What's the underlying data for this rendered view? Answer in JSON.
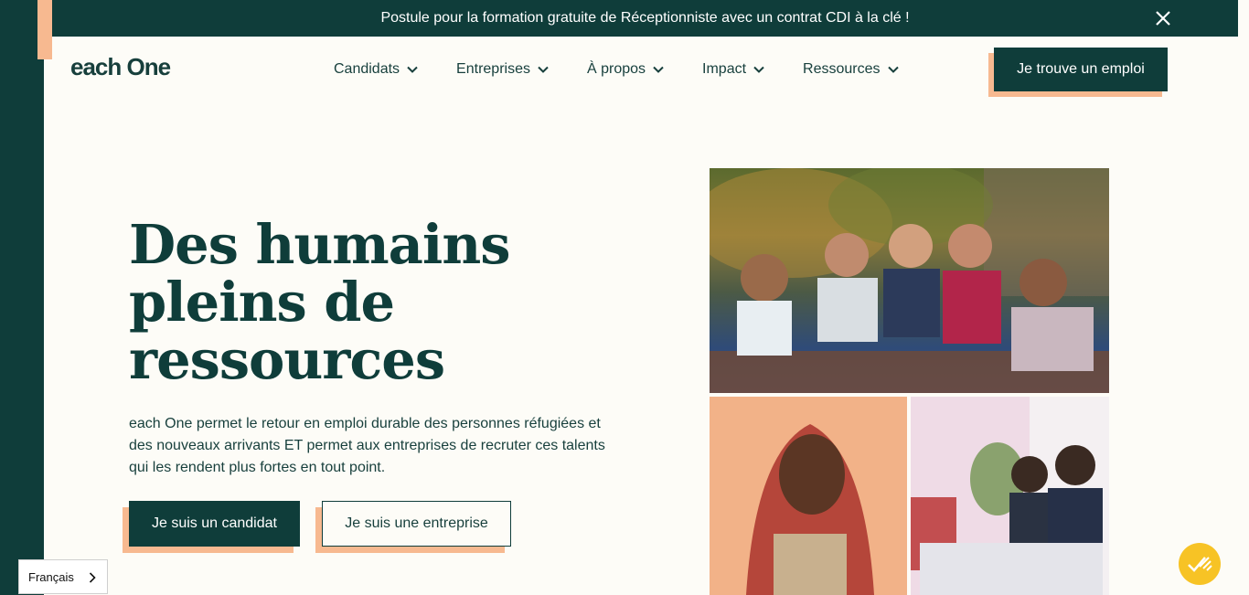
{
  "announcement": {
    "text": "Postule pour la formation gratuite de Réceptionniste avec un contrat CDI à la clé !",
    "close_icon": "close-icon"
  },
  "header": {
    "logo": "each One",
    "nav": [
      {
        "label": "Candidats"
      },
      {
        "label": "Entreprises"
      },
      {
        "label": "À propos"
      },
      {
        "label": "Impact"
      },
      {
        "label": "Ressources"
      }
    ],
    "cta_label": "Je trouve un emploi"
  },
  "hero": {
    "title_line1": "Des humains",
    "title_line2": "pleins de",
    "title_line3": "ressources",
    "description": "each One permet le retour en emploi durable des personnes réfugiées et des nouveaux arrivants ET permet aux entreprises de recruter ces talents qui les rendent plus fortes en tout point.",
    "primary_button": "Je suis un candidat",
    "secondary_button": "Je suis une entreprise"
  },
  "language": {
    "current": "Français"
  },
  "colors": {
    "brand_dark": "#0f3d3a",
    "accent_peach": "#f7b990",
    "background": "#fdfcf7",
    "badge_yellow": "#f7c325"
  }
}
